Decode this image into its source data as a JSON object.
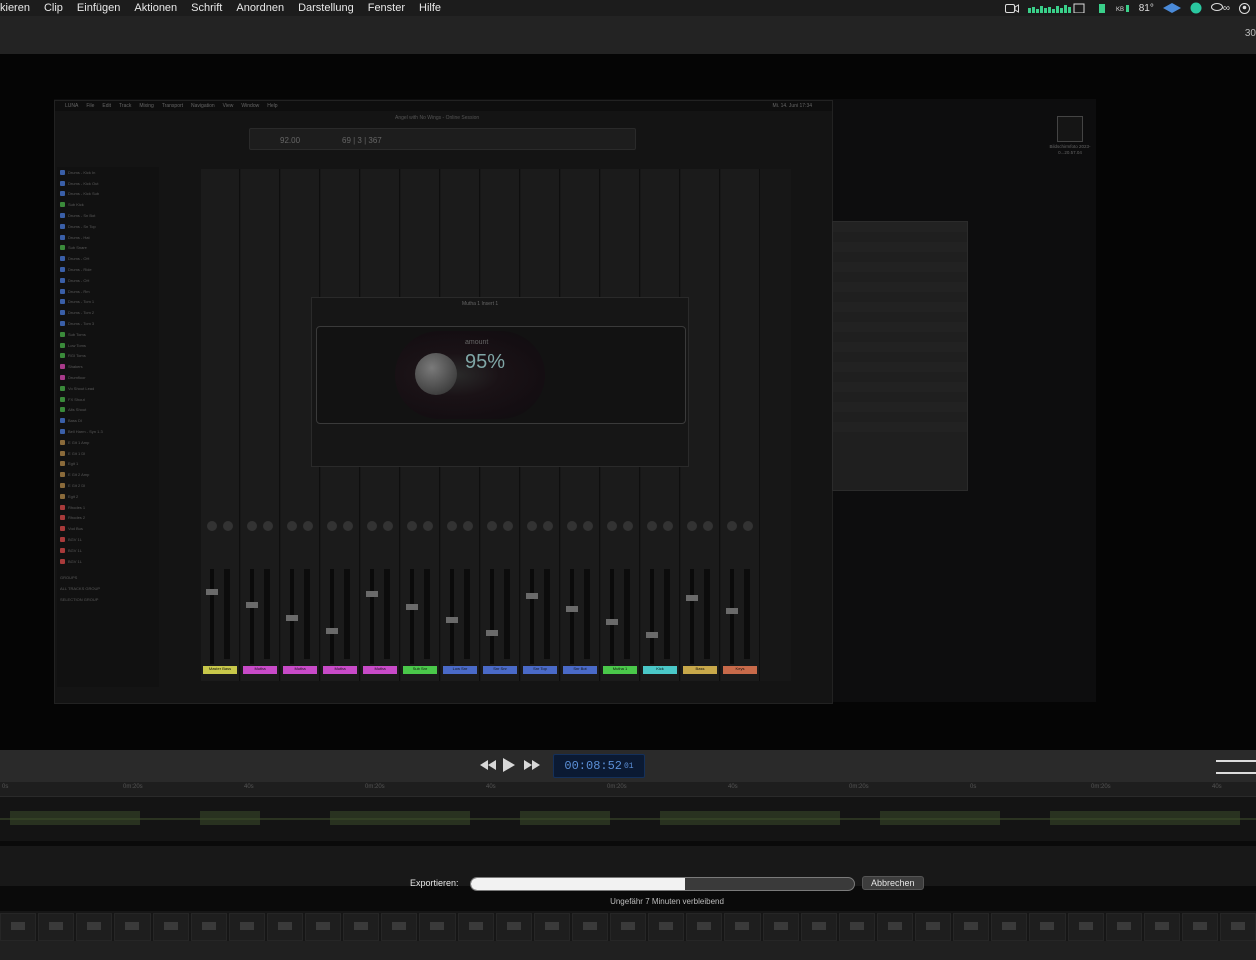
{
  "menubar": {
    "items": [
      "kieren",
      "Clip",
      "Einfügen",
      "Aktionen",
      "Schrift",
      "Anordnen",
      "Darstellung",
      "Fenster",
      "Hilfe"
    ],
    "temperature": "81°",
    "battery": "∞"
  },
  "toolbar": {
    "right_text": "30"
  },
  "luna": {
    "menu": [
      "LUNA",
      "File",
      "Edit",
      "Track",
      "Mixing",
      "Transport",
      "Navigation",
      "View",
      "Window",
      "Help"
    ],
    "title": "Angel with No Wings - Online Session",
    "tempo": "92.00",
    "position": "69 | 3 | 367",
    "plugin_title": "Mutha 1 Insert 1",
    "plugin_amount_label": "amount",
    "plugin_amount": "95%",
    "clock": "Mi. 14. Juni 17:34"
  },
  "tracks": [
    {
      "name": "Drums - Kick In",
      "color": "#3a5fa8"
    },
    {
      "name": "Drums - Kick Out",
      "color": "#3a5fa8"
    },
    {
      "name": "Drums - Kick Sub",
      "color": "#3a5fa8"
    },
    {
      "name": "Sub Kick",
      "color": "#3a8a3a"
    },
    {
      "name": "Drums - Sn Bot",
      "color": "#3a5fa8"
    },
    {
      "name": "Drums - Sn Top",
      "color": "#3a5fa8"
    },
    {
      "name": "Drums - Hat",
      "color": "#3a5fa8"
    },
    {
      "name": "Sub Snare",
      "color": "#3a8a3a"
    },
    {
      "name": "Drums - OH",
      "color": "#3a5fa8"
    },
    {
      "name": "Drums - Ride",
      "color": "#3a5fa8"
    },
    {
      "name": "Drums - OH",
      "color": "#3a5fa8"
    },
    {
      "name": "Drums - Rm",
      "color": "#3a5fa8"
    },
    {
      "name": "Drums - Tom 1",
      "color": "#3a5fa8"
    },
    {
      "name": "Drums - Tom 2",
      "color": "#3a5fa8"
    },
    {
      "name": "Drums - Tom 3",
      "color": "#3a5fa8"
    },
    {
      "name": "Sub Toms",
      "color": "#3a8a3a"
    },
    {
      "name": "Low Toms",
      "color": "#3a8a3a"
    },
    {
      "name": "RGI Toms",
      "color": "#3a8a3a"
    },
    {
      "name": "Shakers",
      "color": "#a83a8a"
    },
    {
      "name": "Drumfloor",
      "color": "#a83a8a"
    },
    {
      "name": "Vo Shout Lead",
      "color": "#3a8a3a"
    },
    {
      "name": "FX Shout",
      "color": "#3a8a3a"
    },
    {
      "name": "Alts Shout",
      "color": "#3a8a3a"
    },
    {
      "name": "Bass DI",
      "color": "#3a5fa8"
    },
    {
      "name": "Bell Harm - Syn 1.3",
      "color": "#3a5fa8"
    },
    {
      "name": "E Git 1 Amp",
      "color": "#8a6a3a"
    },
    {
      "name": "E Git 1 DI",
      "color": "#8a6a3a"
    },
    {
      "name": "Egit 1",
      "color": "#8a6a3a"
    },
    {
      "name": "E Git 2 Amp",
      "color": "#8a6a3a"
    },
    {
      "name": "E Git 2 DI",
      "color": "#8a6a3a"
    },
    {
      "name": "Egit 2",
      "color": "#8a6a3a"
    },
    {
      "name": "Rhodes 1",
      "color": "#a83a3a"
    },
    {
      "name": "Rhodes 2",
      "color": "#a83a3a"
    },
    {
      "name": "Vod Bus",
      "color": "#a83a3a"
    },
    {
      "name": "BGV 1L",
      "color": "#a83a3a"
    },
    {
      "name": "BGV 1L",
      "color": "#a83a3a"
    },
    {
      "name": "BGV 1L",
      "color": "#a83a3a"
    }
  ],
  "groups": {
    "label": "GROUPS",
    "items": [
      "ALL TRACKS GROUP",
      "SELECTION GROUP"
    ]
  },
  "mixer_strips": [
    {
      "name": "Master Bass",
      "color": "#c8c84a"
    },
    {
      "name": "Mutha",
      "color": "#c84ac8"
    },
    {
      "name": "Mutha",
      "color": "#c84ac8"
    },
    {
      "name": "Mutha",
      "color": "#c84ac8"
    },
    {
      "name": "Mutha",
      "color": "#c84ac8"
    },
    {
      "name": "Sub Snr",
      "color": "#4ac84a"
    },
    {
      "name": "Low Snr",
      "color": "#4a6ac8"
    },
    {
      "name": "Snr Snr",
      "color": "#4a6ac8"
    },
    {
      "name": "Snr Top",
      "color": "#4a6ac8"
    },
    {
      "name": "Snr Bot",
      "color": "#4a6ac8"
    },
    {
      "name": "Mutha 1",
      "color": "#4ac84a"
    },
    {
      "name": "Kick",
      "color": "#4ac8c8"
    },
    {
      "name": "Bass",
      "color": "#c8a84a"
    },
    {
      "name": "Keys",
      "color": "#c86a4a"
    }
  ],
  "thumb": {
    "label": "Bildschirmfoto 2023-0...20.57.04"
  },
  "playback": {
    "timecode": "00:08:52",
    "frames": "01"
  },
  "ruler": {
    "ticks": [
      "0s",
      "0m:20s",
      "40s",
      "0m:20s",
      "40s",
      "0m:20s",
      "40s",
      "0m:20s",
      "0s",
      "0m:20s",
      "40s"
    ]
  },
  "export": {
    "label": "Exportieren:",
    "progress_fraction": 0.56,
    "cancel_label": "Abbrechen",
    "remaining": "Ungefähr 7 Minuten verbleibend"
  }
}
